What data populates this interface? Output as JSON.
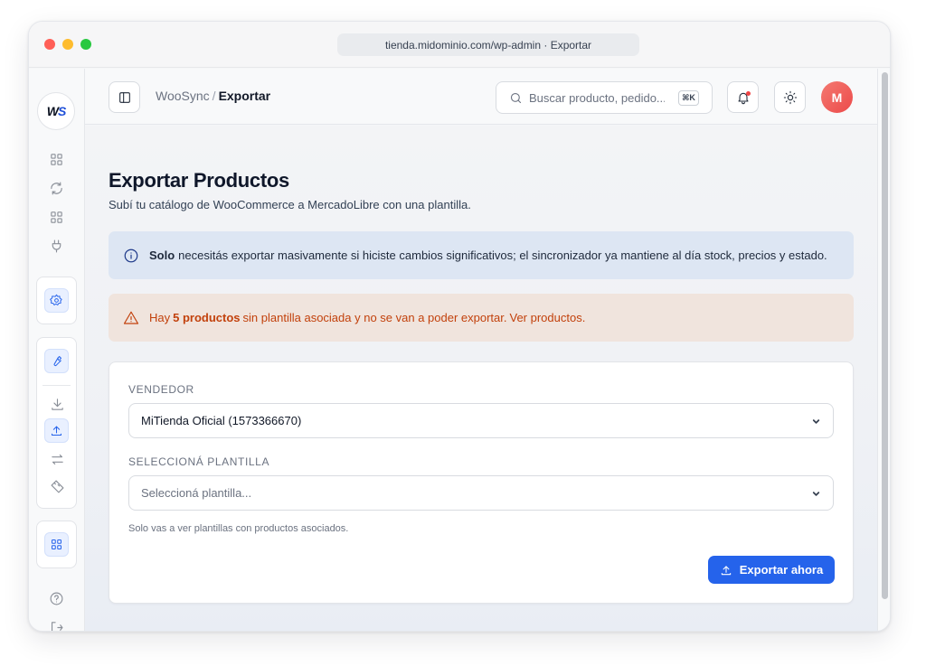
{
  "window": {
    "url": "tienda.midominio.com/wp-admin · Exportar"
  },
  "sidebar": {
    "logo": {
      "w": "W",
      "s": "S"
    },
    "icons": [
      "dashboard-icon",
      "sync-icon",
      "grid-icon",
      "plug-icon",
      "settings-icon",
      "wrench-icon",
      "download-icon",
      "upload-icon",
      "transfer-icon",
      "ruler-icon",
      "apps-icon",
      "help-icon",
      "logout-icon"
    ]
  },
  "header": {
    "breadcrumb_root": "WooSync",
    "breadcrumb_sep": "/",
    "breadcrumb_current": "Exportar",
    "search_placeholder": "Buscar producto, pedido...",
    "search_shortcut": "⌘K",
    "avatar_initial": "M"
  },
  "page": {
    "title": "Exportar Productos",
    "subtitle": "Subí tu catálogo de WooCommerce a MercadoLibre con una plantilla."
  },
  "info_alert": {
    "bold": "Solo",
    "text": "necesitás exportar masivamente si hiciste cambios significativos; el sincronizador ya mantiene al día stock, precios y estado."
  },
  "warning_alert": {
    "prefix": "Hay",
    "bold": "5 productos",
    "text": "sin plantilla asociada y no se van a poder exportar.",
    "link": "Ver productos."
  },
  "form": {
    "seller_label": "VENDEDOR",
    "seller_value": "MiTienda Oficial (1573366670)",
    "template_label": "SELECCIONÁ PLANTILLA",
    "template_placeholder": "Seleccioná plantilla...",
    "hint": "Solo vas a ver plantillas con productos asociados.",
    "export_button": "Exportar ahora"
  },
  "colors": {
    "primary": "#2563eb",
    "info_bg": "#dde6f3",
    "warning_bg": "#f0e4dd",
    "warning_text": "#c2410c",
    "avatar": "#ec4a4a"
  }
}
